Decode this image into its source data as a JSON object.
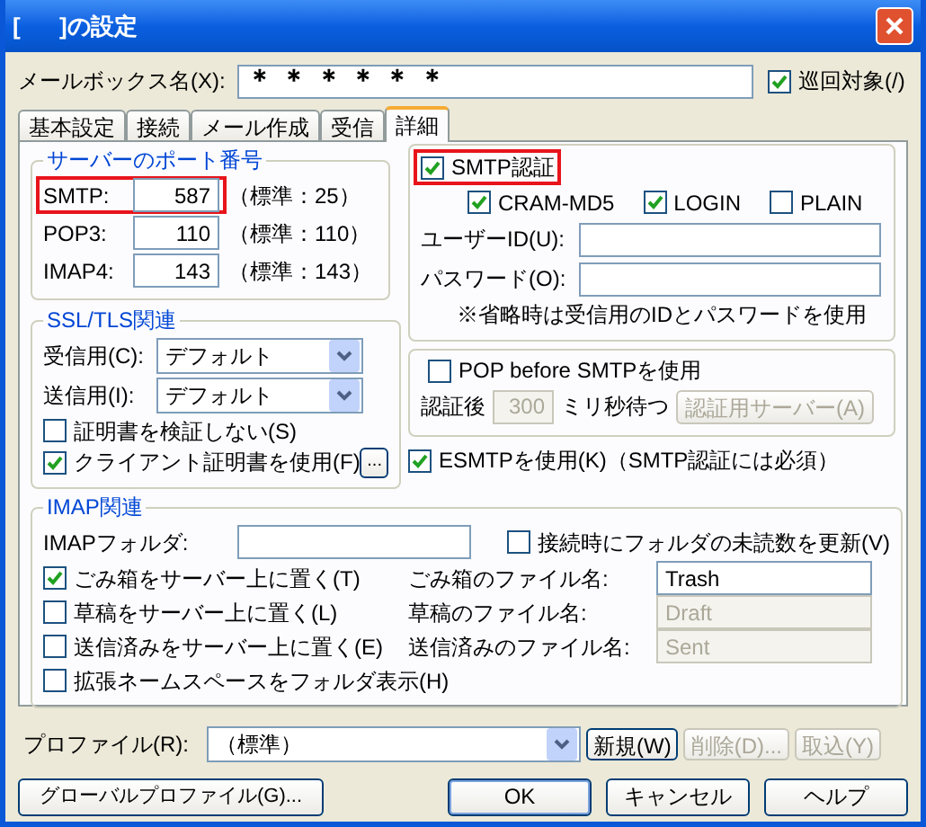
{
  "window": {
    "title": "[      ]の設定"
  },
  "mailbox": {
    "label": "メールボックス名(X):",
    "value": "＊ ＊ ＊ ＊ ＊ ＊",
    "patrol": {
      "label": "巡回対象(/)",
      "checked": true
    }
  },
  "tabs": [
    {
      "label": "基本設定",
      "selected": false
    },
    {
      "label": "接続",
      "selected": false
    },
    {
      "label": "メール作成",
      "selected": false
    },
    {
      "label": "受信",
      "selected": false
    },
    {
      "label": "詳細",
      "selected": true
    }
  ],
  "ports": {
    "title": "サーバーのポート番号",
    "rows": [
      {
        "label": "SMTP:",
        "value": "587",
        "default": "（標準：25）",
        "highlighted": true
      },
      {
        "label": "POP3:",
        "value": "110",
        "default": "（標準：110）",
        "highlighted": false
      },
      {
        "label": "IMAP4:",
        "value": "143",
        "default": "（標準：143）",
        "highlighted": false
      }
    ]
  },
  "ssl": {
    "title": "SSL/TLS関連",
    "selects": [
      {
        "label": "受信用(C):",
        "value": "デフォルト"
      },
      {
        "label": "送信用(I):",
        "value": "デフォルト"
      }
    ],
    "checks": [
      {
        "label": "証明書を検証しない(S)",
        "checked": false
      },
      {
        "label": "クライアント証明書を使用(F)",
        "checked": true
      }
    ],
    "browse_button": "..."
  },
  "smtp_auth": {
    "label": "SMTP認証",
    "checked": true,
    "highlighted": true,
    "methods": [
      {
        "label": "CRAM-MD5",
        "checked": true
      },
      {
        "label": "LOGIN",
        "checked": true
      },
      {
        "label": "PLAIN",
        "checked": false
      }
    ],
    "fields": [
      {
        "label": "ユーザーID(U):"
      },
      {
        "label": "パスワード(O):"
      }
    ],
    "note": "※省略時は受信用のIDとパスワードを使用"
  },
  "pop_before": {
    "label": "POP before SMTPを使用",
    "checked": false,
    "wait_label": "認証後",
    "wait_value": "300",
    "wait_unit": "ミリ秒待つ",
    "server_button": "認証用サーバー(A)"
  },
  "esmtp": {
    "label": "ESMTPを使用(K)（SMTP認証には必須）",
    "checked": true
  },
  "imap": {
    "title": "IMAP関連",
    "folder_label": "IMAPフォルダ:",
    "update": {
      "label": "接続時にフォルダの未読数を更新(V)",
      "checked": false
    },
    "rows": [
      {
        "label": "ごみ箱をサーバー上に置く(T)",
        "checked": true,
        "name_label": "ごみ箱のファイル名:",
        "name_value": "Trash"
      },
      {
        "label": "草稿をサーバー上に置く(L)",
        "checked": false,
        "name_label": "草稿のファイル名:",
        "name_value": "Draft"
      },
      {
        "label": "送信済みをサーバー上に置く(E)",
        "checked": false,
        "name_label": "送信済みのファイル名:",
        "name_value": "Sent"
      }
    ],
    "namespace": {
      "label": "拡張ネームスペースをフォルダ表示(H)",
      "checked": false
    }
  },
  "profile": {
    "label": "プロファイル(R):",
    "value": "（標準）",
    "buttons": [
      {
        "label": "新規(W)",
        "disabled": false
      },
      {
        "label": "削除(D)...",
        "disabled": true
      },
      {
        "label": "取込(Y)",
        "disabled": true
      }
    ]
  },
  "footer": {
    "global_button": "グローバルプロファイル(G)...",
    "buttons": [
      {
        "label": "OK",
        "default": true
      },
      {
        "label": "キャンセル",
        "default": false
      },
      {
        "label": "ヘルプ",
        "default": false
      }
    ]
  }
}
